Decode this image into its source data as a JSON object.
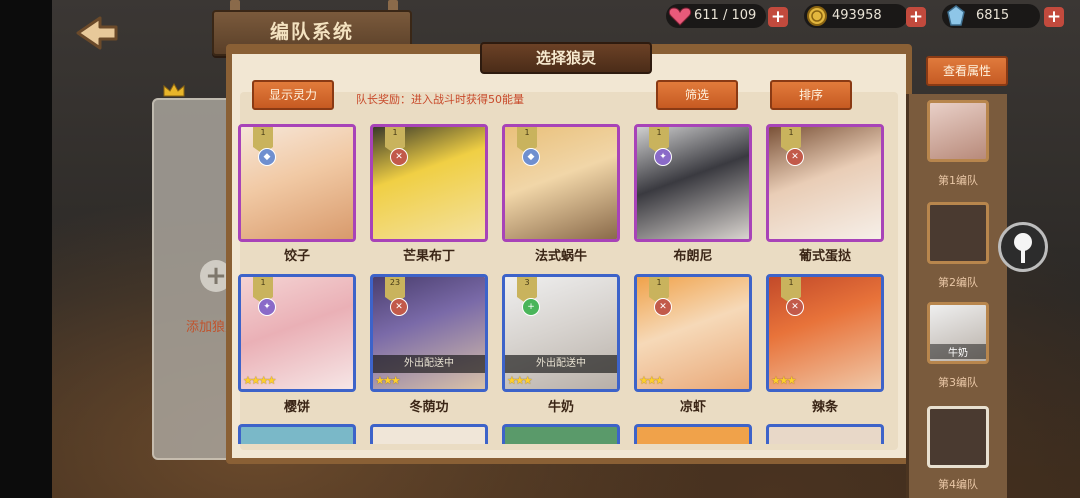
{
  "header": {
    "title": "编队系统"
  },
  "resources": {
    "stamina": "611 / 109",
    "coins": "493958",
    "gems": "6815",
    "plus": "+"
  },
  "panel": {
    "title": "选择狼灵",
    "show_power": "显示灵力",
    "leader_bonus": "队长奖励：进入战斗时获得50能量",
    "filter": "筛选",
    "sort": "排序"
  },
  "team": {
    "add_symbol": "+",
    "add_label": "添加狼灵"
  },
  "cards_row1": [
    {
      "name": "饺子",
      "frame": "purple",
      "level": "1",
      "badge_color": "#6f8fcf"
    },
    {
      "name": "芒果布丁",
      "frame": "purple",
      "level": "1",
      "badge_color": "#c25a4a"
    },
    {
      "name": "法式蜗牛",
      "frame": "purple",
      "level": "1",
      "badge_color": "#6f8fcf"
    },
    {
      "name": "布朗尼",
      "frame": "purple",
      "level": "1",
      "badge_color": "#8a6ac8"
    },
    {
      "name": "葡式蛋挞",
      "frame": "purple",
      "level": "1",
      "badge_color": "#c25a4a"
    }
  ],
  "cards_row2": [
    {
      "name": "樱饼",
      "frame": "blue",
      "level": "1",
      "badge_color": "#8a6ac8",
      "stars": "★★★★",
      "dispatch": ""
    },
    {
      "name": "冬荫功",
      "frame": "blue",
      "level": "23",
      "badge_color": "#c25a4a",
      "stars": "★★★",
      "dispatch": "外出配送中"
    },
    {
      "name": "牛奶",
      "frame": "blue",
      "level": "3",
      "badge_color": "#4ab55a",
      "stars": "★★★",
      "dispatch": "外出配送中"
    },
    {
      "name": "凉虾",
      "frame": "blue",
      "level": "1",
      "badge_color": "#c25a4a",
      "stars": "★★★",
      "dispatch": ""
    },
    {
      "name": "辣条",
      "frame": "blue",
      "level": "1",
      "badge_color": "#c25a4a",
      "stars": "★★★",
      "dispatch": ""
    }
  ],
  "right": {
    "view_attr": "查看属性",
    "slots": [
      "第1编队",
      "第2编队",
      "第3编队",
      "第4编队"
    ],
    "slot3_name": "牛奶"
  }
}
